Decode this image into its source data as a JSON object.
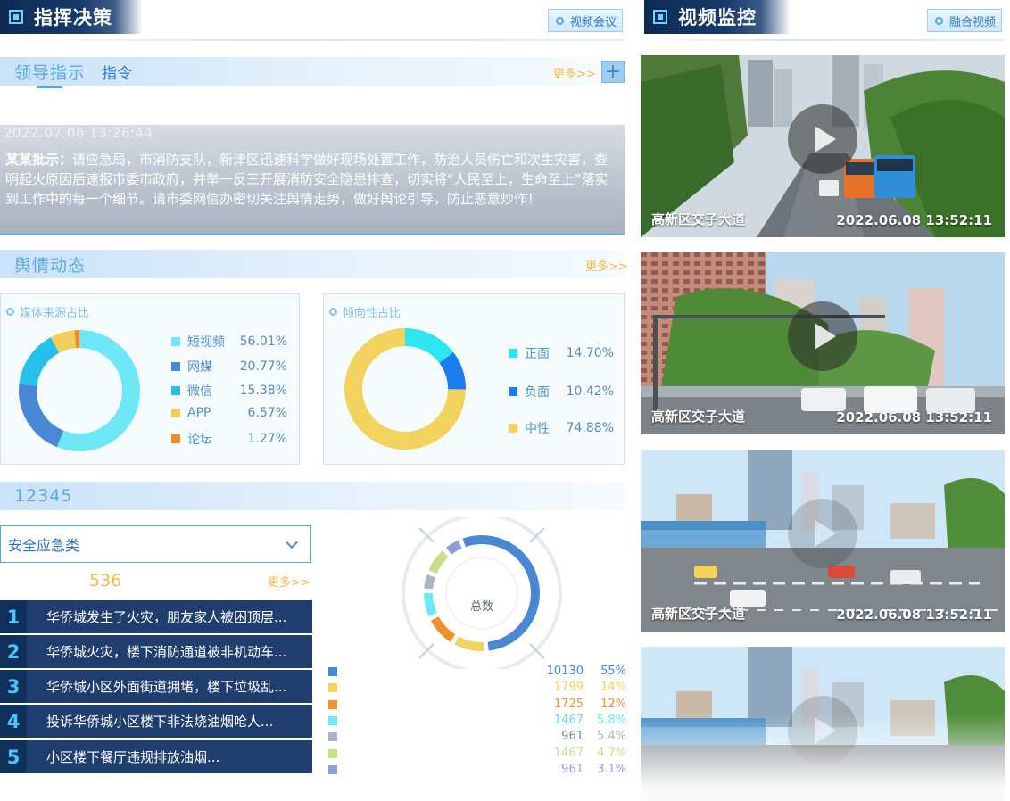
{
  "command": {
    "title": "指挥决策",
    "video_meeting_button": "视频会议"
  },
  "leader": {
    "title": "领导指示",
    "tab2": "指令",
    "more": "更多>>",
    "time": "2022.07.06  13:26:44",
    "author": "某某批示：",
    "content": "请应急局，市消防支队，新津区迅速科学做好现场处置工作，防治人员伤亡和次生灾害，查明起火原因后速报市委市政府，并举一反三开展消防安全隐患排查，切实将“人民至上，生命至上”落实到工作中的每一个细节。请市委网信办密切关注舆情走势，做好舆论引导，防止恶意炒作！"
  },
  "opinion": {
    "title": "舆情动态",
    "more": "更多>>",
    "media_title": "媒体来源占比",
    "tendency_title": "倾向性占比"
  },
  "chart_data": [
    {
      "type": "pie",
      "title": "媒体来源占比",
      "categories": [
        "短视频",
        "网媒",
        "微信",
        "APP",
        "论坛"
      ],
      "values": [
        56.01,
        20.77,
        15.38,
        6.57,
        1.27
      ],
      "labels": [
        "56.01%",
        "20.77%",
        "15.38%",
        "6.57%",
        "1.27%"
      ],
      "colors": [
        "#6ee7f7",
        "#4a88d6",
        "#25c1ec",
        "#f2cd5c",
        "#ef8a2e"
      ]
    },
    {
      "type": "pie",
      "title": "倾向性占比",
      "categories": [
        "正面",
        "负面",
        "中性"
      ],
      "values": [
        14.7,
        10.42,
        74.88
      ],
      "labels": [
        "14.70%",
        "10.42%",
        "74.88%"
      ],
      "colors": [
        "#2ee6f0",
        "#1a7ef0",
        "#f2d35e"
      ]
    },
    {
      "type": "pie",
      "title": "总数",
      "values": [
        10130,
        1799,
        1725,
        1467,
        961,
        1467,
        961
      ],
      "value_labels": [
        "10130",
        "1799",
        "1725",
        "1467",
        "961",
        "1467",
        "961"
      ],
      "percent_labels": [
        "55%",
        "14%",
        "12%",
        "5.8%",
        "5.4%",
        "4.7%",
        "3.1%"
      ],
      "colors": [
        "#4a88d6",
        "#f2d35e",
        "#ef922e",
        "#6ee7f7",
        "#aab4c2",
        "#c5df8a",
        "#8f9fd4"
      ]
    }
  ],
  "hotline": {
    "title": "12345",
    "category": "安全应急类",
    "count": "536",
    "more": "更多>>",
    "items": [
      {
        "num": "1",
        "text": "华侨城发生了火灾，朋友家人被困顶层..."
      },
      {
        "num": "2",
        "text": "华侨城火灾，楼下消防通道被非机动车..."
      },
      {
        "num": "3",
        "text": "华侨城小区外面街道拥堵，楼下垃圾乱..."
      },
      {
        "num": "4",
        "text": "投诉华侨城小区楼下非法烧油烟呛人..."
      },
      {
        "num": "5",
        "text": "小区楼下餐厅违规排放油烟..."
      }
    ]
  },
  "video": {
    "title": "视频监控",
    "fusion_button": "融合视频",
    "feeds": [
      {
        "location": "高新区交子大道",
        "time": "2022.06.08  13:52:11"
      },
      {
        "location": "高新区交子大道",
        "time": "2022.06.08  13:52:11"
      },
      {
        "location": "高新区交子大道",
        "time": "2022.06.08  13:52:11"
      },
      {
        "location": "",
        "time": ""
      }
    ]
  }
}
